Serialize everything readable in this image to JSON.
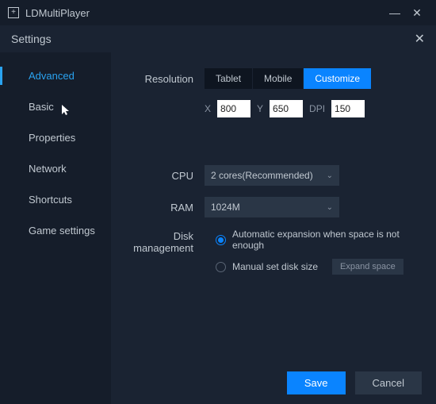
{
  "titlebar": {
    "app_name": "LDMultiPlayer"
  },
  "settings_header": {
    "title": "Settings"
  },
  "sidebar": {
    "items": [
      {
        "label": "Advanced",
        "active": true
      },
      {
        "label": "Basic"
      },
      {
        "label": "Properties"
      },
      {
        "label": "Network"
      },
      {
        "label": "Shortcuts"
      },
      {
        "label": "Game settings"
      }
    ]
  },
  "resolution": {
    "label": "Resolution",
    "tabs": {
      "tablet": "Tablet",
      "mobile": "Mobile",
      "customize": "Customize"
    },
    "x_label": "X",
    "x_value": "800",
    "y_label": "Y",
    "y_value": "650",
    "dpi_label": "DPI",
    "dpi_value": "150"
  },
  "cpu": {
    "label": "CPU",
    "value": "2 cores(Recommended)"
  },
  "ram": {
    "label": "RAM",
    "value": "1024M"
  },
  "disk": {
    "label": "Disk management",
    "auto": "Automatic expansion when space is not enough",
    "manual": "Manual set disk size",
    "expand": "Expand space"
  },
  "footer": {
    "save": "Save",
    "cancel": "Cancel"
  }
}
